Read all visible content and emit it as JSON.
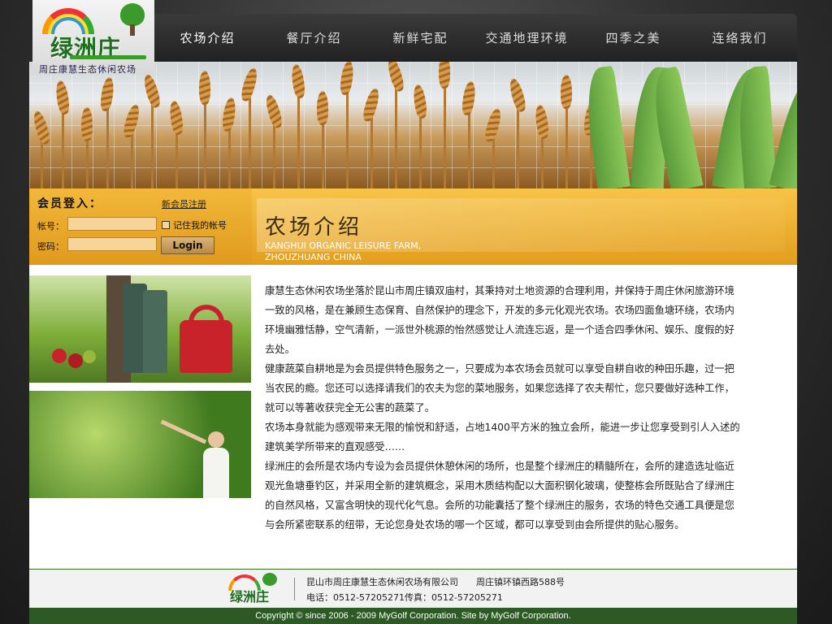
{
  "logo": {
    "brand": "绿洲庄",
    "slogan": "周庄康慧生态休闲农场"
  },
  "nav": {
    "items": [
      "农场介绍",
      "餐厅介绍",
      "新鲜宅配",
      "交通地理环境",
      "四季之美",
      "连络我们"
    ],
    "active": 0
  },
  "login": {
    "title": "会员登入：",
    "register_link": "新会员注册",
    "account_label": "帐号：",
    "password_label": "密码：",
    "account_value": "",
    "password_value": "",
    "remember_label": "记住我的帐号",
    "login_button": "Login"
  },
  "page": {
    "title": "农场介绍",
    "subtitle_en": "KANGHUI ORGANIC LEISURE FARM, ZHOUZHUANG CHINA"
  },
  "article": {
    "paragraphs": [
      "康慧生态休闲农场坐落於昆山市周庄镇双庙村，其秉持对土地资源的合理利用，并保持于周庄休闲旅游环境一致的风格，是在兼顾生态保育、自然保护的理念下，开发的多元化观光农场。农场四面鱼塘环绕，农场内环境幽雅恬静，空气清新，一派世外桃源的怡然感觉让人流连忘返，是一个适合四季休闲、娱乐、度假的好去处。",
      "健康蔬菜自耕地是为会员提供特色服务之一，只要成为本农场会员就可以享受自耕自收的种田乐趣，过一把当农民的瘾。您还可以选择请我们的农夫为您的菜地服务，如果您选择了农夫帮忙，您只要做好选种工作，就可以等著收获完全无公害的蔬菜了。",
      "农场本身就能为感观带来无限的愉悦和舒适，占地1400平方米的独立会所，能进一步让您享受到引人入述的建筑美学所带来的直观感受……",
      "绿洲庄的会所是农场内专设为会员提供休憩休闲的场所，也是整个绿洲庄的精髓所在，会所的建造选址临近观光鱼塘垂钓区，并采用全新的建筑概念，采用木质结构配以大面积钢化玻璃，使整栋会所既贴合了绿洲庄的自然风格，又富含明快的现代化气息。会所的功能囊括了整个绿洲庄的服务，农场的特色交通工具便是您与会所紧密联系的纽带，无论您身处农场的哪一个区域，都可以享受到由会所提供的贴心服务。"
    ]
  },
  "footer": {
    "logo_text": "绿洲庄",
    "line1": "昆山市周庄康慧生态休闲农场有限公司　　周庄镇环镇西路588号",
    "line2": "电话：0512-57205271传真：0512-57205271",
    "copyright": "Copyright © since 2006 - 2009 MyGolf Corporation. Site by MyGolf Corporation."
  },
  "colors": {
    "accent": "#e39d1c",
    "footer_green": "#2d5a24",
    "nav_bg": "#2a2a2a"
  }
}
